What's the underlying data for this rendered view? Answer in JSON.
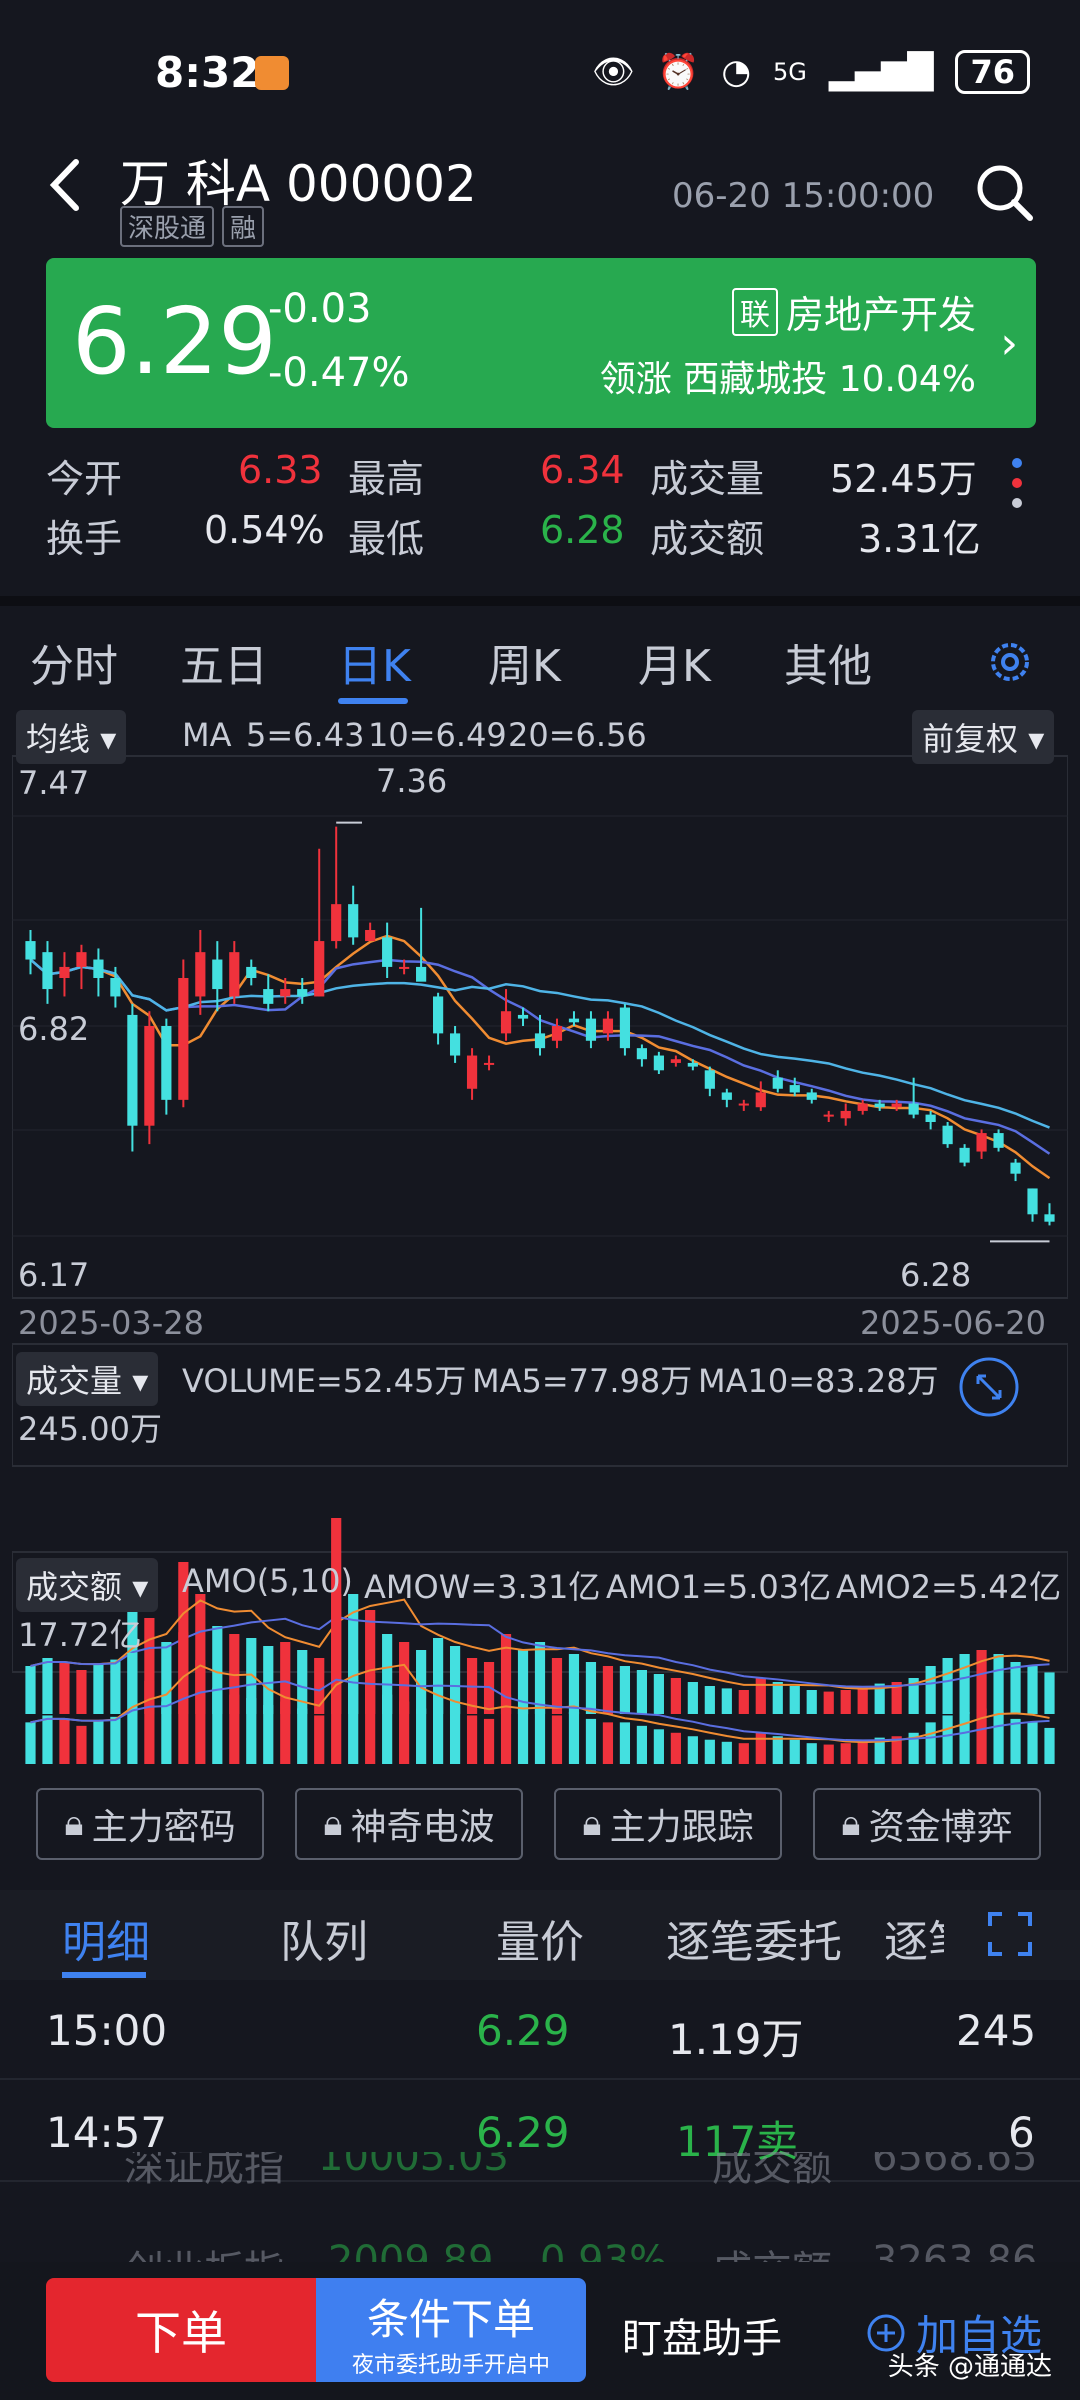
{
  "status_bar": {
    "time": "8:32",
    "network": "5G",
    "battery": "76"
  },
  "header": {
    "name": "万 科A 000002",
    "tags": [
      "深股通",
      "融"
    ],
    "datetime": "06-20 15:00:00"
  },
  "price": {
    "last": "6.29",
    "change": "-0.03",
    "change_pct": "-0.47%",
    "sector_tag": "联",
    "sector": "房地产开发",
    "lead_label": "领涨",
    "lead_stock": "西藏城投",
    "lead_pct": "10.04%"
  },
  "stats": {
    "open_label": "今开",
    "open": "6.33",
    "high_label": "最高",
    "high": "6.34",
    "vol_label": "成交量",
    "vol": "52.45万",
    "turnover_label": "换手",
    "turnover": "0.54%",
    "low_label": "最低",
    "low": "6.28",
    "amt_label": "成交额",
    "amt": "3.31亿"
  },
  "tabs": [
    "分时",
    "五日",
    "日K",
    "周K",
    "月K",
    "其他"
  ],
  "active_tab": 2,
  "colors": {
    "up": "#f0323c",
    "down": "#44e0e0",
    "ma5": "#f08c32",
    "ma10": "#5a6ee0",
    "ma20": "#4fb4e6",
    "accent": "#3f82f0",
    "green": "#27a950"
  },
  "kline": {
    "indicator_btn": "均线",
    "ma_label": "MA",
    "ma5": "5=6.43",
    "ma10": "10=6.49",
    "ma20": "20=6.56",
    "adjust_btn": "前复权",
    "y_top": "7.47",
    "y_mid": "6.82",
    "y_bot": "6.17",
    "peak_label": "7.36",
    "low_label": "6.28",
    "date_start": "2025-03-28",
    "date_end": "2025-06-20"
  },
  "chart_data": {
    "type": "candlestick",
    "y_range": [
      6.17,
      7.47
    ],
    "candles": [
      [
        7.05,
        7.0,
        7.08,
        6.96
      ],
      [
        7.02,
        6.92,
        7.05,
        6.88
      ],
      [
        6.95,
        6.98,
        7.02,
        6.9
      ],
      [
        6.98,
        7.02,
        7.04,
        6.92
      ],
      [
        7.0,
        6.95,
        7.03,
        6.9
      ],
      [
        6.95,
        6.9,
        6.98,
        6.87
      ],
      [
        6.85,
        6.55,
        6.88,
        6.48
      ],
      [
        6.55,
        6.82,
        6.86,
        6.5
      ],
      [
        6.82,
        6.62,
        6.84,
        6.58
      ],
      [
        6.62,
        6.95,
        7.0,
        6.6
      ],
      [
        6.9,
        7.02,
        7.08,
        6.85
      ],
      [
        7.0,
        6.92,
        7.05,
        6.86
      ],
      [
        6.9,
        7.02,
        7.05,
        6.88
      ],
      [
        6.98,
        6.95,
        7.0,
        6.93
      ],
      [
        6.92,
        6.88,
        6.96,
        6.86
      ],
      [
        6.9,
        6.92,
        6.95,
        6.88
      ],
      [
        6.92,
        6.9,
        6.95,
        6.88
      ],
      [
        6.9,
        7.05,
        7.3,
        6.9
      ],
      [
        7.05,
        7.15,
        7.36,
        7.03
      ],
      [
        7.15,
        7.06,
        7.2,
        7.04
      ],
      [
        7.05,
        7.08,
        7.1,
        7.05
      ],
      [
        7.06,
        6.98,
        7.1,
        6.95
      ],
      [
        6.98,
        6.98,
        7.0,
        6.96
      ],
      [
        6.98,
        6.94,
        7.14,
        6.95
      ],
      [
        6.9,
        6.8,
        6.91,
        6.77
      ],
      [
        6.8,
        6.74,
        6.82,
        6.72
      ],
      [
        6.65,
        6.74,
        6.76,
        6.62
      ],
      [
        6.72,
        6.72,
        6.74,
        6.7
      ],
      [
        6.8,
        6.86,
        6.92,
        6.78
      ],
      [
        6.85,
        6.84,
        6.87,
        6.82
      ],
      [
        6.8,
        6.76,
        6.85,
        6.74
      ],
      [
        6.78,
        6.82,
        6.84,
        6.76
      ],
      [
        6.84,
        6.83,
        6.86,
        6.82
      ],
      [
        6.84,
        6.78,
        6.86,
        6.76
      ],
      [
        6.8,
        6.84,
        6.86,
        6.78
      ],
      [
        6.87,
        6.76,
        6.88,
        6.74
      ],
      [
        6.76,
        6.73,
        6.77,
        6.71
      ],
      [
        6.74,
        6.7,
        6.75,
        6.69
      ],
      [
        6.72,
        6.73,
        6.74,
        6.71
      ],
      [
        6.72,
        6.71,
        6.73,
        6.7
      ],
      [
        6.7,
        6.65,
        6.71,
        6.63
      ],
      [
        6.64,
        6.62,
        6.65,
        6.6
      ],
      [
        6.61,
        6.61,
        6.62,
        6.59
      ],
      [
        6.6,
        6.64,
        6.67,
        6.59
      ],
      [
        6.68,
        6.65,
        6.7,
        6.64
      ],
      [
        6.66,
        6.64,
        6.68,
        6.63
      ],
      [
        6.64,
        6.62,
        6.65,
        6.61
      ],
      [
        6.58,
        6.58,
        6.59,
        6.56
      ],
      [
        6.57,
        6.59,
        6.61,
        6.55
      ],
      [
        6.59,
        6.61,
        6.62,
        6.58
      ],
      [
        6.61,
        6.6,
        6.62,
        6.59
      ],
      [
        6.6,
        6.61,
        6.62,
        6.59
      ],
      [
        6.61,
        6.58,
        6.68,
        6.57
      ],
      [
        6.58,
        6.56,
        6.59,
        6.54
      ],
      [
        6.55,
        6.5,
        6.56,
        6.49
      ],
      [
        6.49,
        6.45,
        6.5,
        6.44
      ],
      [
        6.48,
        6.53,
        6.54,
        6.46
      ],
      [
        6.53,
        6.49,
        6.54,
        6.48
      ],
      [
        6.45,
        6.42,
        6.46,
        6.4
      ],
      [
        6.38,
        6.31,
        6.38,
        6.29
      ],
      [
        6.31,
        6.29,
        6.34,
        6.28
      ]
    ],
    "volume": {
      "label": "成交量",
      "main": "VOLUME=52.45万",
      "ma5": "MA5=77.98万",
      "ma10": "MA10=83.28万",
      "max": "245.00万"
    },
    "amount": {
      "label": "成交额",
      "main": "AMO(5,10)",
      "amow": "AMOW=3.31亿",
      "amo1": "AMO1=5.03亿",
      "amo2": "AMO2=5.42亿",
      "max": "17.72亿"
    },
    "vol_values": [
      60,
      70,
      65,
      55,
      62,
      68,
      160,
      120,
      90,
      190,
      150,
      110,
      100,
      95,
      85,
      90,
      80,
      70,
      245,
      150,
      130,
      100,
      90,
      80,
      95,
      85,
      70,
      65,
      100,
      80,
      90,
      70,
      75,
      65,
      60,
      60,
      55,
      50,
      45,
      40,
      35,
      32,
      30,
      45,
      40,
      35,
      30,
      28,
      30,
      35,
      38,
      40,
      45,
      60,
      70,
      75,
      80,
      75,
      65,
      60,
      52
    ]
  },
  "function_buttons": [
    "主力密码",
    "神奇电波",
    "主力跟踪",
    "资金博弈"
  ],
  "detail_tabs": [
    "明细",
    "队列",
    "量价",
    "逐笔委托",
    "逐笔"
  ],
  "trades": [
    {
      "time": "15:00",
      "price": "6.29",
      "vol": "1.19万",
      "count": "245"
    },
    {
      "time": "14:57",
      "price": "6.29",
      "vol": "117卖",
      "count": "6"
    }
  ],
  "indices": [
    {
      "name": "深证成指",
      "value": "10005.03",
      "label": "成交额",
      "amt": "6568.65"
    },
    {
      "name": "创业板指",
      "value": "2009.89",
      "pct": "0.93%",
      "label": "成交额",
      "amt": "3263.86"
    }
  ],
  "bottom": {
    "order": "下单",
    "cond": "条件下单",
    "cond_sub": "夜市委托助手开启中",
    "watch": "盯盘助手",
    "add": "加自选",
    "watermark": "头条 @通通达"
  }
}
